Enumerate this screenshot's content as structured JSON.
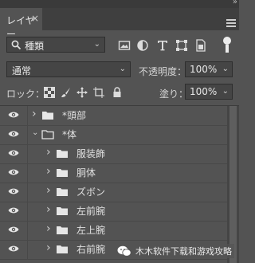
{
  "window": {
    "collapse_glyph": "»",
    "menu_icon": "hamburger-menu-icon"
  },
  "tab": {
    "label": "レイヤー",
    "close": "×"
  },
  "filter": {
    "label": "種類",
    "icons": [
      "image-filter-icon",
      "adjustment-filter-icon",
      "type-filter-icon",
      "shape-filter-icon",
      "smart-object-filter-icon"
    ],
    "toggle": "filter-toggle-icon"
  },
  "blend": {
    "mode": "通常",
    "opacity_label": "不透明度：",
    "opacity_value": "100%"
  },
  "lock": {
    "label": "ロック：",
    "icons": [
      "lock-transparent-pixels-icon",
      "lock-image-pixels-icon",
      "lock-position-icon",
      "lock-artboard-icon",
      "lock-all-icon"
    ],
    "fill_label": "塗り：",
    "fill_value": "100%"
  },
  "layers": [
    {
      "name": "*頭部",
      "level": 0,
      "expanded": false
    },
    {
      "name": "*体",
      "level": 0,
      "expanded": true
    },
    {
      "name": "服装飾",
      "level": 1,
      "expanded": false
    },
    {
      "name": "胴体",
      "level": 1,
      "expanded": false
    },
    {
      "name": "ズボン",
      "level": 1,
      "expanded": false
    },
    {
      "name": "左前腕",
      "level": 1,
      "expanded": false
    },
    {
      "name": "左上腕",
      "level": 1,
      "expanded": false
    },
    {
      "name": "右前腕",
      "level": 1,
      "expanded": false
    }
  ],
  "watermark": {
    "text": "木木软件下载和游戏攻略"
  }
}
